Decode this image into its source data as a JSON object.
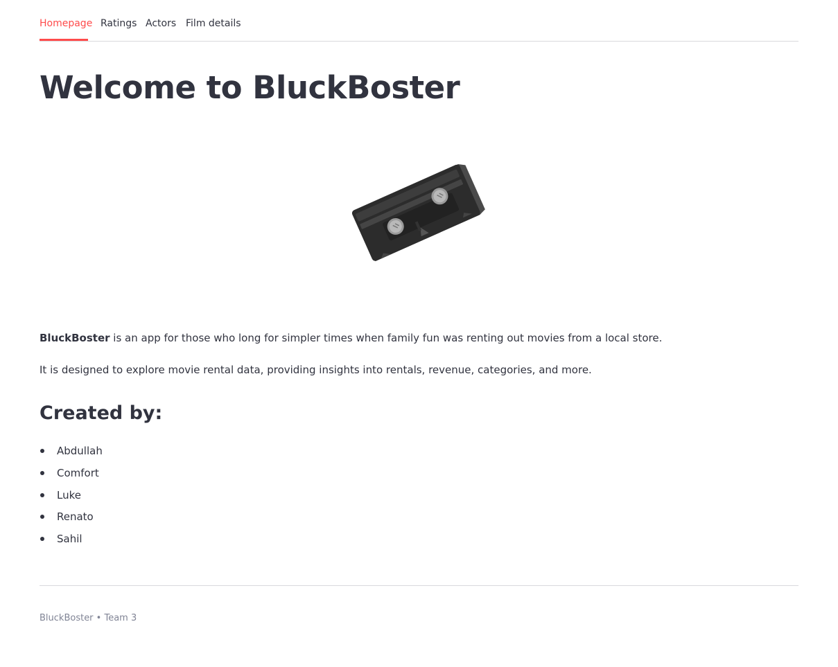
{
  "tabs": [
    {
      "label": "Homepage",
      "active": true
    },
    {
      "label": "Ratings",
      "active": false
    },
    {
      "label": "Actors",
      "active": false
    },
    {
      "label": "Film details",
      "active": false
    }
  ],
  "accent_color": "#ff4b4b",
  "title": "Welcome to BluckBoster",
  "hero_image": {
    "icon": "vhs-cassette-icon"
  },
  "intro": {
    "brand": "BluckBoster",
    "text": " is an app for those who long for simpler times when family fun was renting out movies from a local store."
  },
  "description": "It is designed to explore movie rental data, providing insights into rentals, revenue, categories, and more.",
  "credits": {
    "heading": "Created by:",
    "authors": [
      "Abdullah",
      "Comfort",
      "Luke",
      "Renato",
      "Sahil"
    ]
  },
  "footer": {
    "caption": "BluckBoster • Team 3"
  }
}
